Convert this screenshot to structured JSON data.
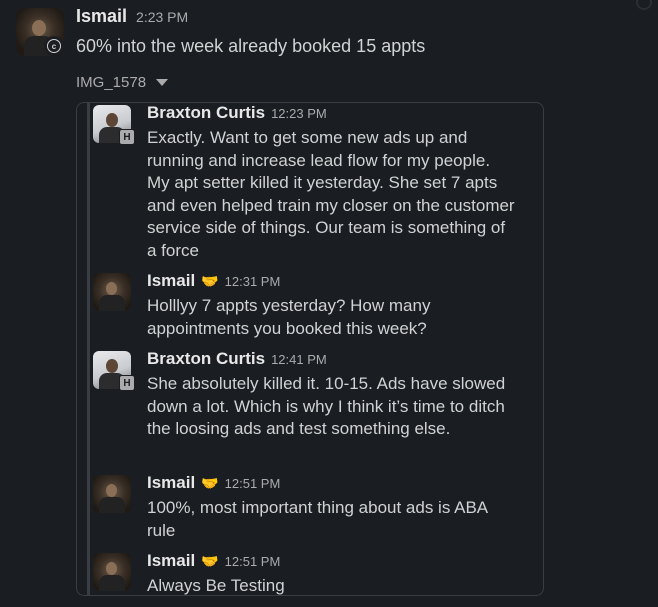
{
  "message": {
    "sender": "Ismail",
    "time": "2:23 PM",
    "text": "60% into the week already booked 15 appts",
    "attachment_name": "IMG_1578"
  },
  "thread": [
    {
      "name": "Braxton Curtis",
      "emoji": "",
      "time": "12:23 PM",
      "badge": "H",
      "text": "Exactly. Want to get some new ads up and running and increase lead flow for my people. My apt setter killed it yesterday. She set 7 apts and even helped train my closer on the customer service side of things. Our team is something of a force"
    },
    {
      "name": "Ismail",
      "emoji": "🤝",
      "time": "12:31 PM",
      "badge": "",
      "text": "Holllyy 7 appts yesterday? How many appointments you booked this week?"
    },
    {
      "name": "Braxton Curtis",
      "emoji": "",
      "time": "12:41 PM",
      "badge": "H",
      "text": "She absolutely killed it. 10-15. Ads have slowed down a lot. Which is why I think it’s time to ditch the loosing ads and test something else."
    },
    {
      "name": "Ismail",
      "emoji": "🤝",
      "time": "12:51 PM",
      "badge": "",
      "text": "100%, most important thing about ads is ABA rule"
    },
    {
      "name": "Ismail",
      "emoji": "🤝",
      "time": "12:51 PM",
      "badge": "",
      "text": "Always Be Testing"
    }
  ],
  "status_badge_icon": "clock-icon"
}
